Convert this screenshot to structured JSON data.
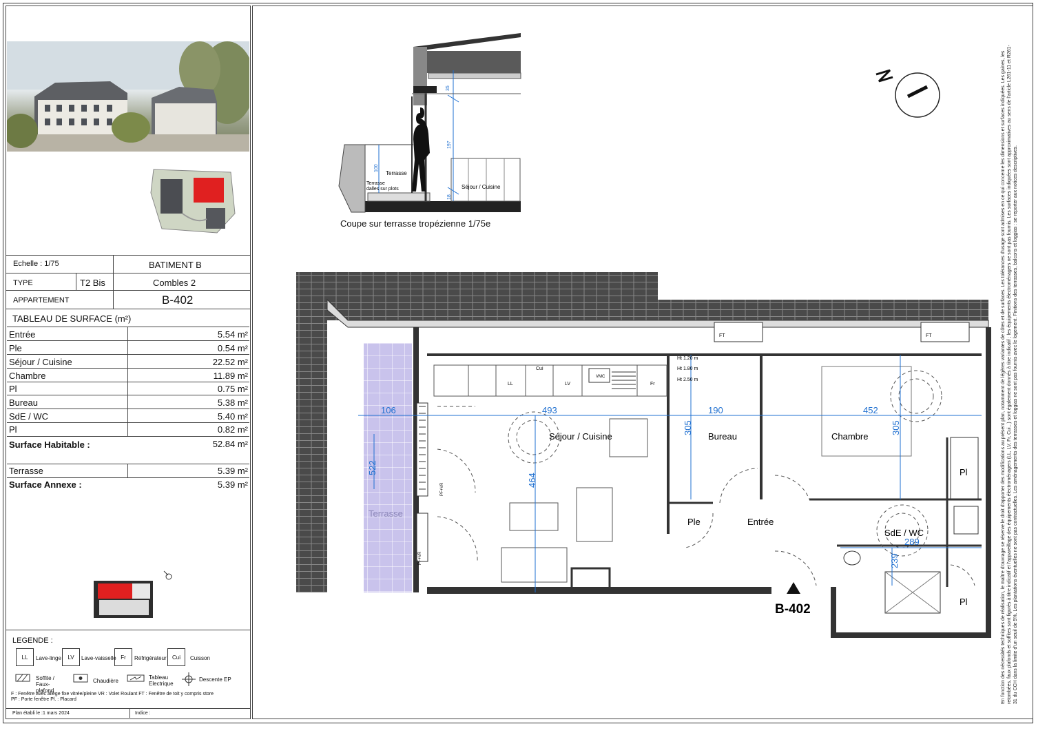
{
  "info": {
    "echelle_label": "Echelle : 1/75",
    "batiment": "BATIMENT B",
    "type_label": "TYPE",
    "type_value": "T2 Bis",
    "niveau": "Combles 2",
    "appartement_label": "APPARTEMENT",
    "appartement_value": "B-402"
  },
  "surface_table": {
    "title": "TABLEAU DE SURFACE (m²)",
    "rows": [
      {
        "label": "Entrée",
        "value": "5.54 m²"
      },
      {
        "label": "Ple",
        "value": "0.54 m²"
      },
      {
        "label": "Séjour / Cuisine",
        "value": "22.52 m²"
      },
      {
        "label": "Chambre",
        "value": "11.89 m²"
      },
      {
        "label": "Pl",
        "value": "0.75 m²"
      },
      {
        "label": "Bureau",
        "value": "5.38 m²"
      },
      {
        "label": "SdE / WC",
        "value": "5.40 m²"
      },
      {
        "label": "Pl",
        "value": "0.82 m²"
      }
    ],
    "habitable_label": "Surface Habitable :",
    "habitable_value": "52.84 m²",
    "terrasse_label": "Terrasse",
    "terrasse_value": "5.39 m²",
    "annexe_label": "Surface Annexe :",
    "annexe_value": "5.39 m²"
  },
  "legend": {
    "title": "LEGENDE :",
    "items": [
      {
        "code": "LL",
        "label": "Lave-linge"
      },
      {
        "code": "LV",
        "label": "Lave-vaisselle"
      },
      {
        "code": "Fr",
        "label": "Réfrigérateur"
      },
      {
        "code": "Cui",
        "label": "Cuisson"
      }
    ],
    "symbols": [
      {
        "label": "Soffite / Faux-plafond"
      },
      {
        "label": "Chaudière"
      },
      {
        "label": "Tableau Electrique"
      },
      {
        "label": "Descente EP"
      }
    ],
    "line1": "F : Fenêtre avec allège fixe vitrée/pleine   VR : Volet Roulant   FT : Fenêtre de toit y compris store",
    "line2": "PF : Porte fenêtre   Pl. : Placard",
    "date": "Plan établi le :1 mars 2024",
    "indice": "Indice :"
  },
  "section": {
    "caption": "Coupe sur terrasse tropézienne 1/75e",
    "terrasse": "Terrasse",
    "terrasse_detail_1": "Terrasse",
    "terrasse_detail_2": "dalles sur plots",
    "sejour": "Séjour / Cuisine",
    "dims": [
      "35",
      "197",
      "100",
      "18"
    ]
  },
  "plan": {
    "rooms": {
      "sejour": "Séjour / Cuisine",
      "bureau": "Bureau",
      "chambre": "Chambre",
      "ple": "Ple",
      "entree": "Entrée",
      "sde": "SdE / WC",
      "pl1": "Pl",
      "pl2": "Pl",
      "terrasse": "Terrasse"
    },
    "dims": {
      "d106": "106",
      "d493": "493",
      "d190": "190",
      "d452": "452",
      "d305a": "305",
      "d305b": "305",
      "d464": "464",
      "d522": "522",
      "d289": "289",
      "d239": "239"
    },
    "kitchen": {
      "ll": "LL",
      "cui": "Cui",
      "lv": "LV",
      "fr": "Fr",
      "vmc": "VMC"
    },
    "heights": [
      "Ht 1.20 m",
      "Ht 1.80 m",
      "Ht 2.50 m"
    ],
    "ft": "FT",
    "pf1": "PF+VR",
    "pf2": "PF+VR",
    "apt_label": "B-402"
  },
  "notes": "En fonction des nécessités techniques de réalisation, le maître d'ouvrage se réserve le droit d'apporter des modifications au présent plan, notamment de légères variantes de côtes et de surfaces. Les tolérances d'usage sont admises en ce qui concerne les dimensions et surfaces indiquées. Les gaines, les retombées, faux plafonds et soffites sont figurés à titre indicatif et l'appareillage des équipements électroménagers (LL, LV, Fr, Cui...) sont également donnés à titre indicatif ; les équipements électroménagers ne sont pas fournis. Les surfaces indiquées sont approximatives au sens de l'article L261-11 et R261-31 du CCH dans la limite d'un seuil de 5%. Les plantations éventuelles ne sont pas contractuelles. Les aménagements des terrasses et loggias ne sont pas fournis avec le logement. Finitions des terrasses, balcons et loggias : se reporter aux notices descriptives.",
  "colors": {
    "terrasse_fill": "#c9c3ec",
    "dim_blue": "#1e6fd0",
    "roof_dark": "#4a4a4a",
    "highlight_red": "#e02020"
  }
}
